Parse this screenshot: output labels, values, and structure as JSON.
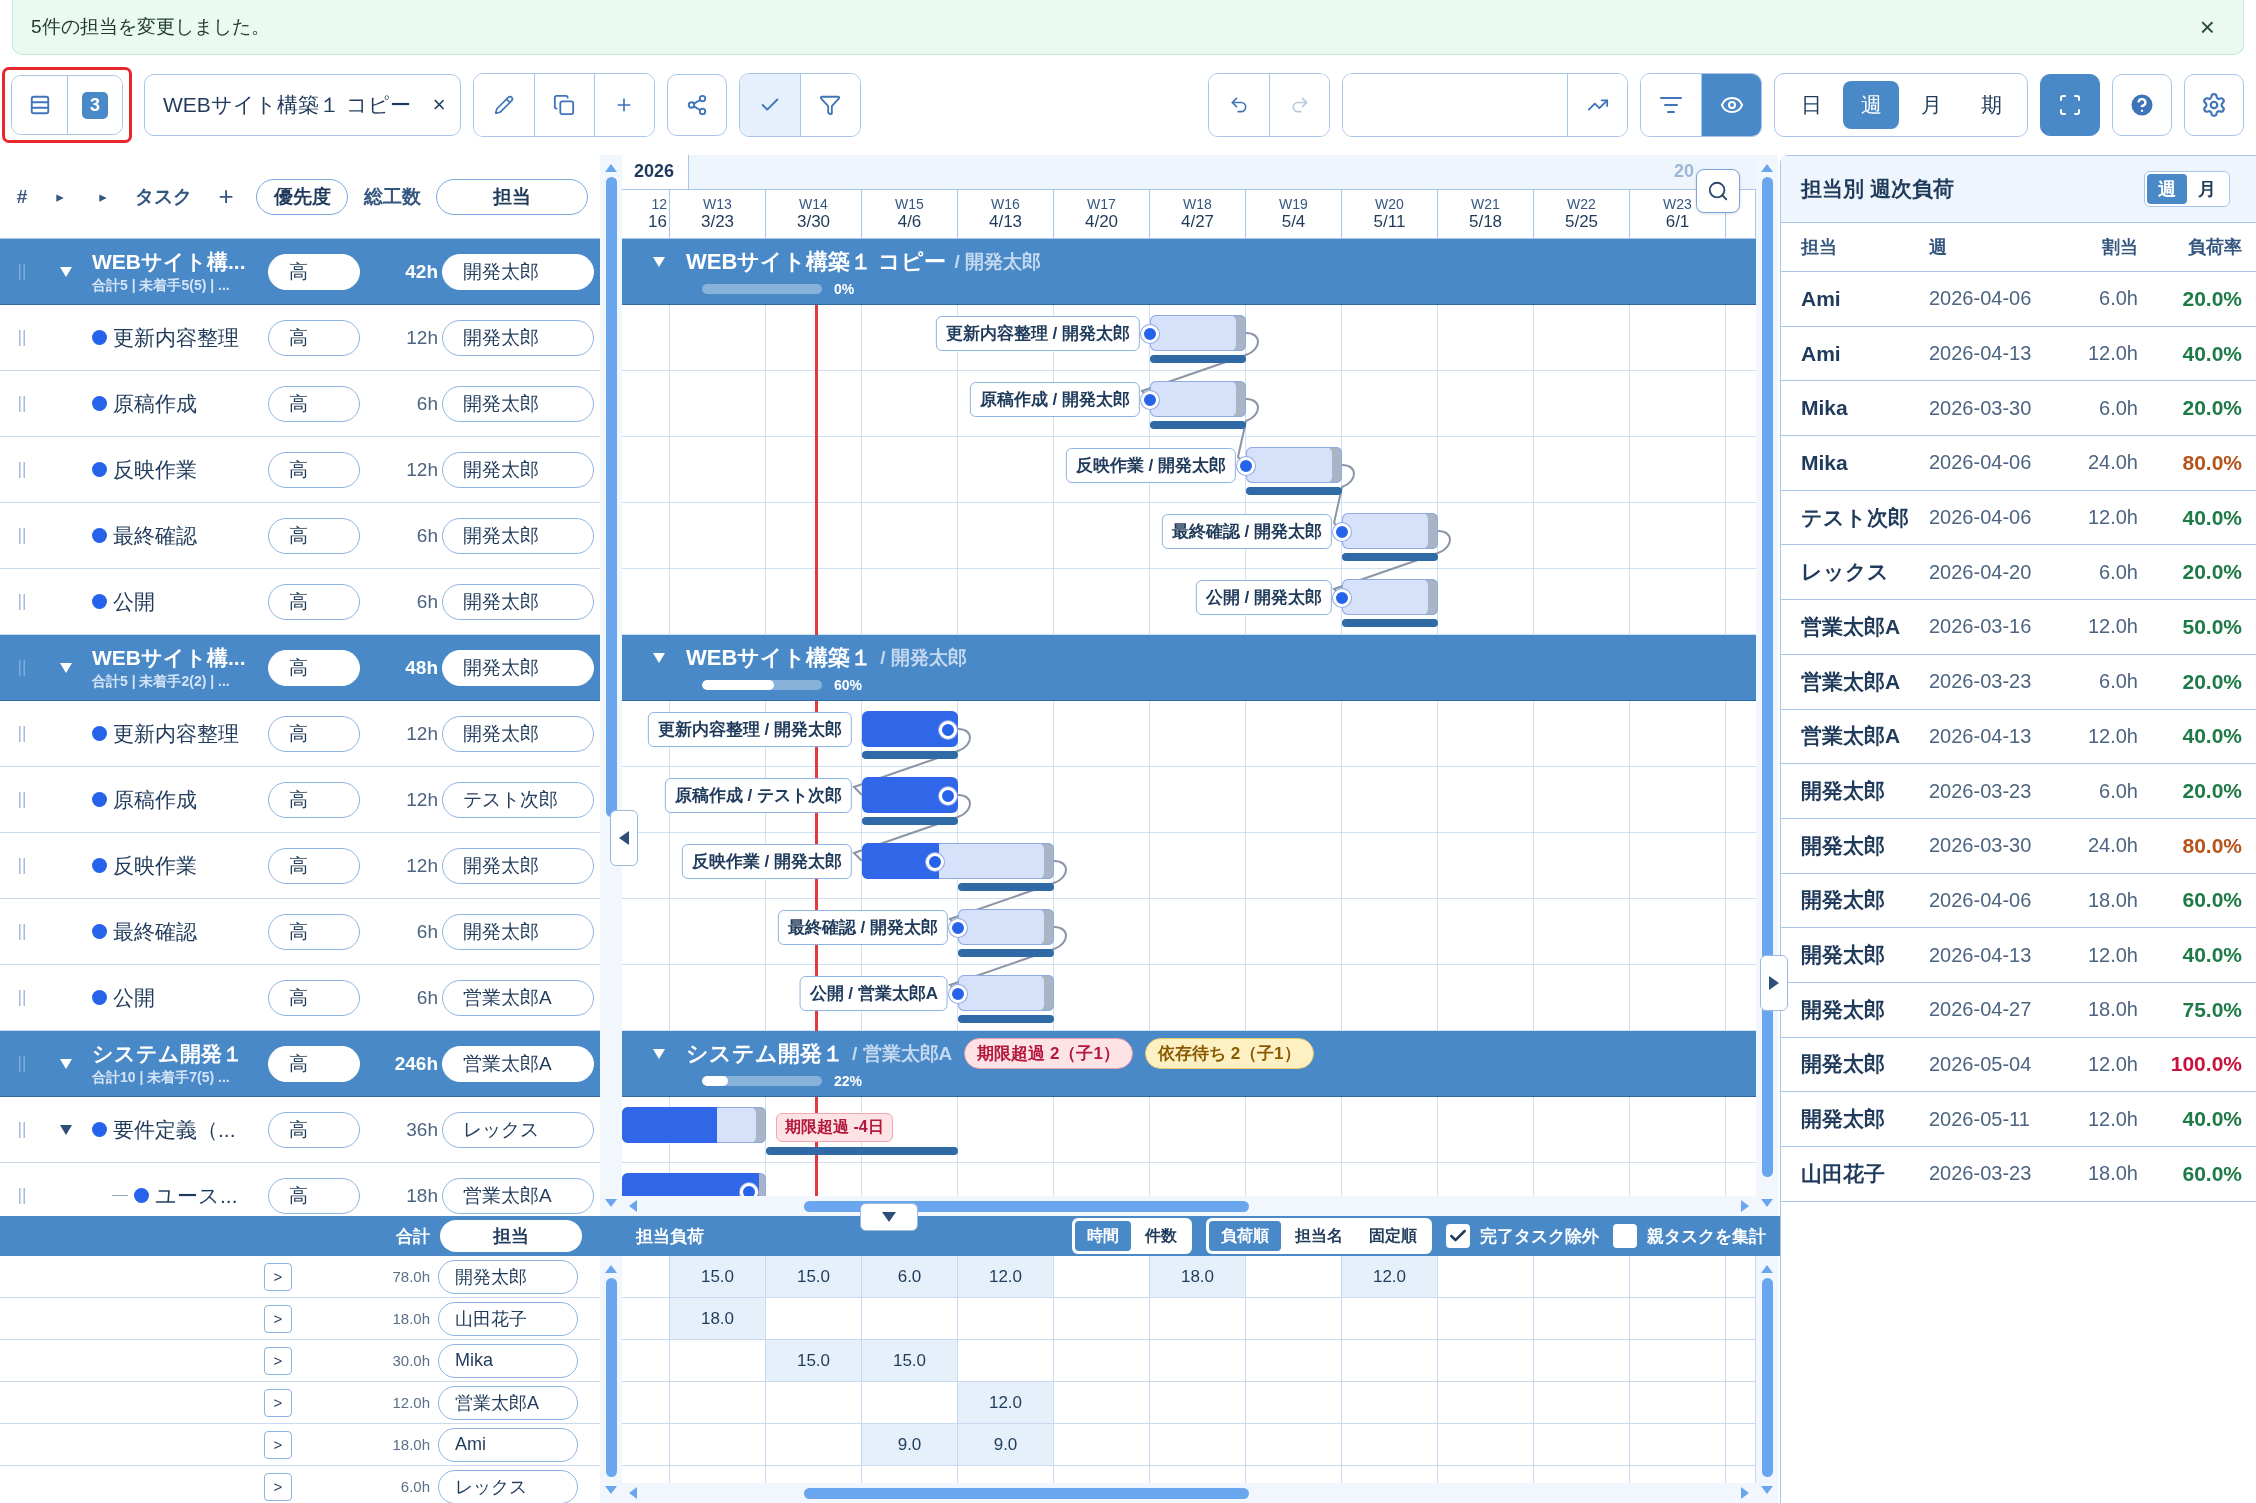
{
  "toast": {
    "message": "5件の担当を変更しました。",
    "close": "×"
  },
  "toolbar": {
    "count_badge": "3",
    "project_tab": {
      "label": "WEBサイト構築１ コピー",
      "close": "×"
    },
    "check_selected": true,
    "eye_selected": true,
    "scale_tabs": [
      {
        "label": "日",
        "selected": false
      },
      {
        "label": "週",
        "selected": true
      },
      {
        "label": "月",
        "selected": false
      },
      {
        "label": "期",
        "selected": false
      }
    ]
  },
  "task_table": {
    "columns": [
      "#",
      "▸",
      "▸",
      "タスク",
      "+",
      "優先度",
      "総工数",
      "担当"
    ],
    "rows": [
      {
        "kind": "group",
        "expanded": true,
        "name": "WEBサイト構...",
        "summary": "合計5 | 未着手5(5) | ...",
        "priority": "高",
        "hours": "42h",
        "assignee": "開発太郎",
        "gantt_title": "WEBサイト構築１ コピー",
        "gantt_owner": "/ 開発太郎",
        "percent": "0%",
        "children": [
          {
            "kind": "task",
            "name": "更新内容整理",
            "priority": "高",
            "hours": "12h",
            "assignee": "開発太郎",
            "bar_label": "更新内容整理 / 開発太郎"
          },
          {
            "kind": "task",
            "name": "原稿作成",
            "priority": "高",
            "hours": "6h",
            "assignee": "開発太郎",
            "bar_label": "原稿作成 / 開発太郎"
          },
          {
            "kind": "task",
            "name": "反映作業",
            "priority": "高",
            "hours": "12h",
            "assignee": "開発太郎",
            "bar_label": "反映作業 / 開発太郎"
          },
          {
            "kind": "task",
            "name": "最終確認",
            "priority": "高",
            "hours": "6h",
            "assignee": "開発太郎",
            "bar_label": "最終確認 / 開発太郎"
          },
          {
            "kind": "task",
            "name": "公開",
            "priority": "高",
            "hours": "6h",
            "assignee": "開発太郎",
            "bar_label": "公開 / 開発太郎"
          }
        ]
      },
      {
        "kind": "group",
        "expanded": true,
        "name": "WEBサイト構...",
        "summary": "合計5 | 未着手2(2) | ...",
        "priority": "高",
        "hours": "48h",
        "assignee": "開発太郎",
        "gantt_title": "WEBサイト構築１",
        "gantt_owner": "/ 開発太郎",
        "percent": "60%",
        "level": 0.6,
        "children": [
          {
            "kind": "task",
            "name": "更新内容整理",
            "priority": "高",
            "hours": "12h",
            "assignee": "開発太郎",
            "bar_label": "更新内容整理 / 開発太郎",
            "level": 1
          },
          {
            "kind": "task",
            "name": "原稿作成",
            "priority": "高",
            "hours": "12h",
            "assignee": "テスト次郎",
            "bar_label": "原稿作成 / テスト次郎",
            "level": 1
          },
          {
            "kind": "task",
            "name": "反映作業",
            "priority": "高",
            "hours": "12h",
            "assignee": "開発太郎",
            "bar_label": "反映作業 / 開発太郎",
            "level": 0.4
          },
          {
            "kind": "task",
            "name": "最終確認",
            "priority": "高",
            "hours": "6h",
            "assignee": "開発太郎",
            "bar_label": "最終確認 / 開発太郎"
          },
          {
            "kind": "task",
            "name": "公開",
            "priority": "高",
            "hours": "6h",
            "assignee": "営業太郎A",
            "bar_label": "公開 / 営業太郎A"
          }
        ]
      },
      {
        "kind": "group",
        "expanded": true,
        "name": "システム開発１",
        "summary": "合計10 | 未着手7(5) ...",
        "priority": "高",
        "hours": "246h",
        "assignee": "営業太郎A",
        "gantt_title": "システム開発１",
        "gantt_owner": "/ 営業太郎A",
        "percent": "22%",
        "level": 0.22,
        "badges": [
          {
            "kind": "overdue",
            "label": "期限超過 2（子1）"
          },
          {
            "kind": "waiting",
            "label": "依存待ち 2（子1）"
          }
        ],
        "children": [
          {
            "kind": "task",
            "expanded": true,
            "name": "要件定義（...",
            "priority": "高",
            "hours": "36h",
            "assignee": "レックス",
            "overdue": "期限超過 -4日",
            "level": 0.66,
            "children": [
              {
                "kind": "task",
                "name": "ユース...",
                "priority": "高",
                "hours": "18h",
                "assignee": "営業太郎A",
                "level": 0.95
              }
            ]
          }
        ]
      }
    ]
  },
  "gantt": {
    "year": "2026",
    "year_next": "20",
    "weeks": [
      {
        "week": "12",
        "date": "16"
      },
      {
        "week": "W13",
        "date": "3/23"
      },
      {
        "week": "W14",
        "date": "3/30"
      },
      {
        "week": "W15",
        "date": "4/6"
      },
      {
        "week": "W16",
        "date": "4/13"
      },
      {
        "week": "W17",
        "date": "4/20"
      },
      {
        "week": "W18",
        "date": "4/27"
      },
      {
        "week": "W19",
        "date": "5/4"
      },
      {
        "week": "W20",
        "date": "5/11"
      },
      {
        "week": "W21",
        "date": "5/18"
      },
      {
        "week": "W22",
        "date": "5/25"
      },
      {
        "week": "W23",
        "date": "6/1"
      }
    ]
  },
  "load_panel": {
    "total_label": "合計",
    "assignee_header": "担当",
    "title": "担当負荷",
    "unit_tabs": [
      {
        "label": "時間",
        "selected": true
      },
      {
        "label": "件数",
        "selected": false
      }
    ],
    "sort_tabs": [
      {
        "label": "負荷順",
        "selected": true
      },
      {
        "label": "担当名",
        "selected": false
      },
      {
        "label": "固定順",
        "selected": false
      }
    ],
    "options": [
      {
        "label": "完了タスク除外",
        "checked": true
      },
      {
        "label": "親タスクを集計",
        "checked": false
      }
    ],
    "rows": [
      {
        "expand": ">",
        "total": "78.0h",
        "assignee": "開発太郎",
        "cells": [
          null,
          "15.0",
          "15.0",
          "6.0",
          "12.0",
          null,
          "18.0",
          null,
          "12.0"
        ]
      },
      {
        "expand": ">",
        "total": "18.0h",
        "assignee": "山田花子",
        "cells": [
          null,
          "18.0"
        ]
      },
      {
        "expand": ">",
        "total": "30.0h",
        "assignee": "Mika",
        "cells": [
          null,
          null,
          "15.0",
          "15.0"
        ]
      },
      {
        "expand": ">",
        "total": "12.0h",
        "assignee": "営業太郎A",
        "cells": [
          null,
          null,
          null,
          null,
          "12.0"
        ]
      },
      {
        "expand": ">",
        "total": "18.0h",
        "assignee": "Ami",
        "cells": [
          null,
          null,
          null,
          "9.0",
          "9.0"
        ]
      },
      {
        "expand": ">",
        "total": "6.0h",
        "assignee": "レックス"
      }
    ]
  },
  "weekly_load": {
    "title": "担当別 週次負荷",
    "tabs": [
      {
        "label": "週",
        "selected": true
      },
      {
        "label": "月",
        "selected": false
      }
    ],
    "columns": [
      "担当",
      "週",
      "割当",
      "負荷率"
    ],
    "rows": [
      {
        "assignee": "Ami",
        "week": "2026-04-06",
        "allocated": "6.0h",
        "rate": "20.0%",
        "color": "#1e7a46"
      },
      {
        "assignee": "Ami",
        "week": "2026-04-13",
        "allocated": "12.0h",
        "rate": "40.0%",
        "color": "#1e7a46"
      },
      {
        "assignee": "Mika",
        "week": "2026-03-30",
        "allocated": "6.0h",
        "rate": "20.0%",
        "color": "#1e7a46"
      },
      {
        "assignee": "Mika",
        "week": "2026-04-06",
        "allocated": "24.0h",
        "rate": "80.0%",
        "color": "#b5541a"
      },
      {
        "assignee": "テスト次郎",
        "week": "2026-04-06",
        "allocated": "12.0h",
        "rate": "40.0%",
        "color": "#1e7a46"
      },
      {
        "assignee": "レックス",
        "week": "2026-04-20",
        "allocated": "6.0h",
        "rate": "20.0%",
        "color": "#1e7a46"
      },
      {
        "assignee": "営業太郎A",
        "week": "2026-03-16",
        "allocated": "12.0h",
        "rate": "50.0%",
        "color": "#1e7a46"
      },
      {
        "assignee": "営業太郎A",
        "week": "2026-03-23",
        "allocated": "6.0h",
        "rate": "20.0%",
        "color": "#1e7a46"
      },
      {
        "assignee": "営業太郎A",
        "week": "2026-04-13",
        "allocated": "12.0h",
        "rate": "40.0%",
        "color": "#1e7a46"
      },
      {
        "assignee": "開発太郎",
        "week": "2026-03-23",
        "allocated": "6.0h",
        "rate": "20.0%",
        "color": "#1e7a46"
      },
      {
        "assignee": "開発太郎",
        "week": "2026-03-30",
        "allocated": "24.0h",
        "rate": "80.0%",
        "color": "#b5541a"
      },
      {
        "assignee": "開発太郎",
        "week": "2026-04-06",
        "allocated": "18.0h",
        "rate": "60.0%",
        "color": "#1e7a46"
      },
      {
        "assignee": "開発太郎",
        "week": "2026-04-13",
        "allocated": "12.0h",
        "rate": "40.0%",
        "color": "#1e7a46"
      },
      {
        "assignee": "開発太郎",
        "week": "2026-04-27",
        "allocated": "18.0h",
        "rate": "75.0%",
        "color": "#1e7a46"
      },
      {
        "assignee": "開発太郎",
        "week": "2026-05-04",
        "allocated": "12.0h",
        "rate": "100.0%",
        "color": "#c8143c"
      },
      {
        "assignee": "開発太郎",
        "week": "2026-05-11",
        "allocated": "12.0h",
        "rate": "40.0%",
        "color": "#1e7a46"
      },
      {
        "assignee": "山田花子",
        "week": "2026-03-23",
        "allocated": "18.0h",
        "rate": "60.0%",
        "color": "#1e7a46"
      }
    ]
  }
}
